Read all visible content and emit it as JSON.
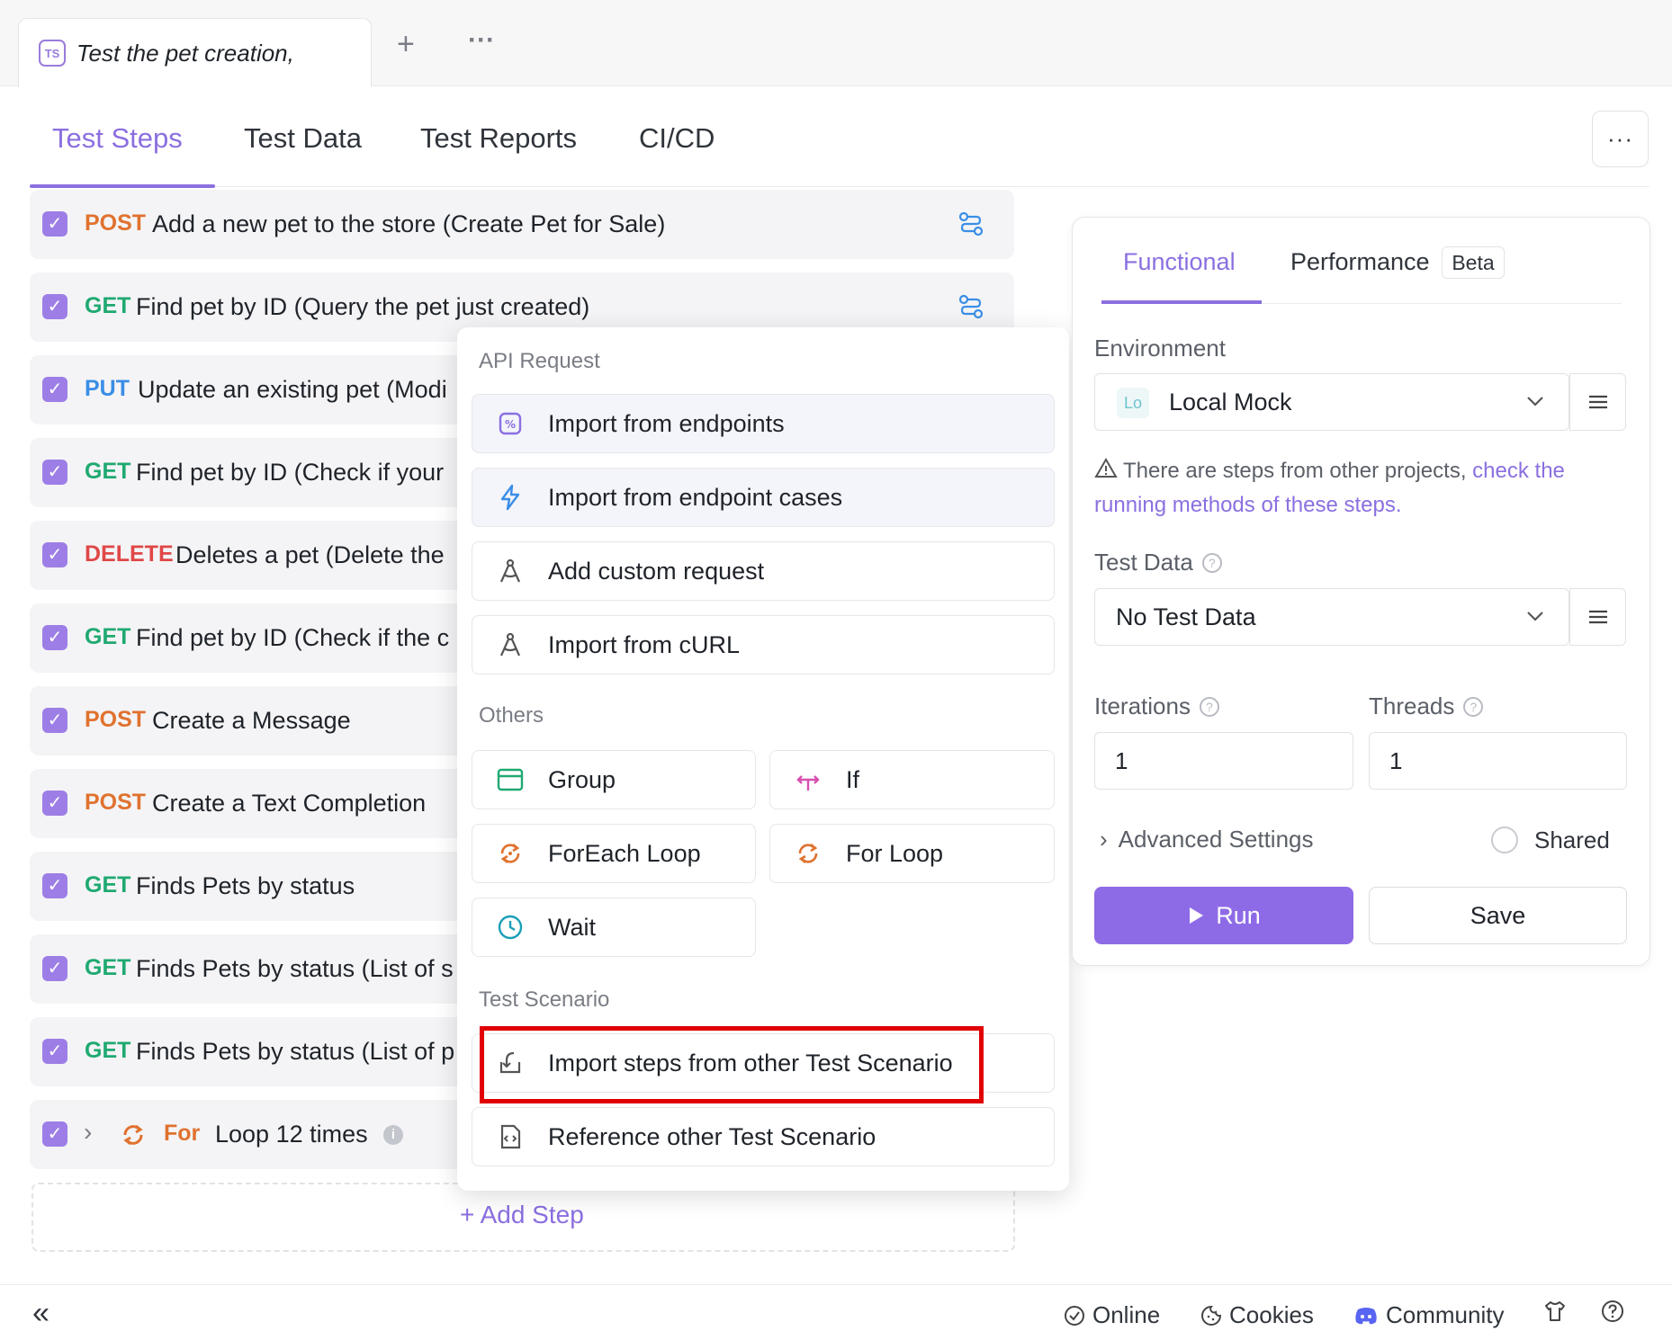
{
  "doc_tab": {
    "badge": "TS",
    "title": "Test the pet creation,"
  },
  "top_controls": {
    "add": "+",
    "more": "···"
  },
  "main_tabs": [
    "Test Steps",
    "Test Data",
    "Test Reports",
    "CI/CD"
  ],
  "more_button": "···",
  "steps": [
    {
      "method": "POST",
      "name": "Add a new pet to the store (Create Pet for Sale)"
    },
    {
      "method": "GET",
      "name": "Find pet by ID (Query the pet just created)"
    },
    {
      "method": "PUT",
      "name": "Update an existing pet (Modi"
    },
    {
      "method": "GET",
      "name": "Find pet by ID (Check if your"
    },
    {
      "method": "DELETE",
      "name": "Deletes a pet (Delete the"
    },
    {
      "method": "GET",
      "name": "Find pet by ID (Check if the c"
    },
    {
      "method": "POST",
      "name": "Create a Message"
    },
    {
      "method": "POST",
      "name": "Create a Text Completion"
    },
    {
      "method": "GET",
      "name": "Finds Pets by status"
    },
    {
      "method": "GET",
      "name": "Finds Pets by status (List of s"
    },
    {
      "method": "GET",
      "name": "Finds Pets by status (List of p"
    }
  ],
  "loop_step": {
    "keyword": "For",
    "name": "Loop 12 times"
  },
  "add_step": "+ Add Step",
  "popup": {
    "api_request_label": "API Request",
    "import_endpoints": "Import from endpoints",
    "import_endpoint_cases": "Import from endpoint cases",
    "add_custom_request": "Add custom request",
    "import_curl": "Import from cURL",
    "others_label": "Others",
    "group": "Group",
    "if": "If",
    "foreach_loop": "ForEach Loop",
    "for_loop": "For Loop",
    "wait": "Wait",
    "test_scenario_label": "Test Scenario",
    "import_steps": "Import steps from other Test Scenario",
    "reference_scenario": "Reference other Test Scenario"
  },
  "panel": {
    "tab_functional": "Functional",
    "tab_performance": "Performance",
    "beta": "Beta",
    "environment_label": "Environment",
    "env_badge": "Lo",
    "env_value": "Local Mock",
    "warning_text": "There are steps from other projects,",
    "warning_link": "check the running methods of these steps.",
    "test_data_label": "Test Data",
    "test_data_value": "No Test Data",
    "iterations_label": "Iterations",
    "iterations_value": "1",
    "threads_label": "Threads",
    "threads_value": "1",
    "advanced_settings": "Advanced Settings",
    "shared_label": "Shared",
    "run": "Run",
    "save": "Save"
  },
  "statusbar": {
    "collapse": "«",
    "online": "Online",
    "cookies": "Cookies",
    "community": "Community"
  },
  "colors": {
    "accent": "#8b6fe0",
    "get": "#1fa971",
    "post": "#e0722f",
    "put": "#3a8ee6",
    "delete": "#e04747",
    "highlight": "#e00000"
  }
}
